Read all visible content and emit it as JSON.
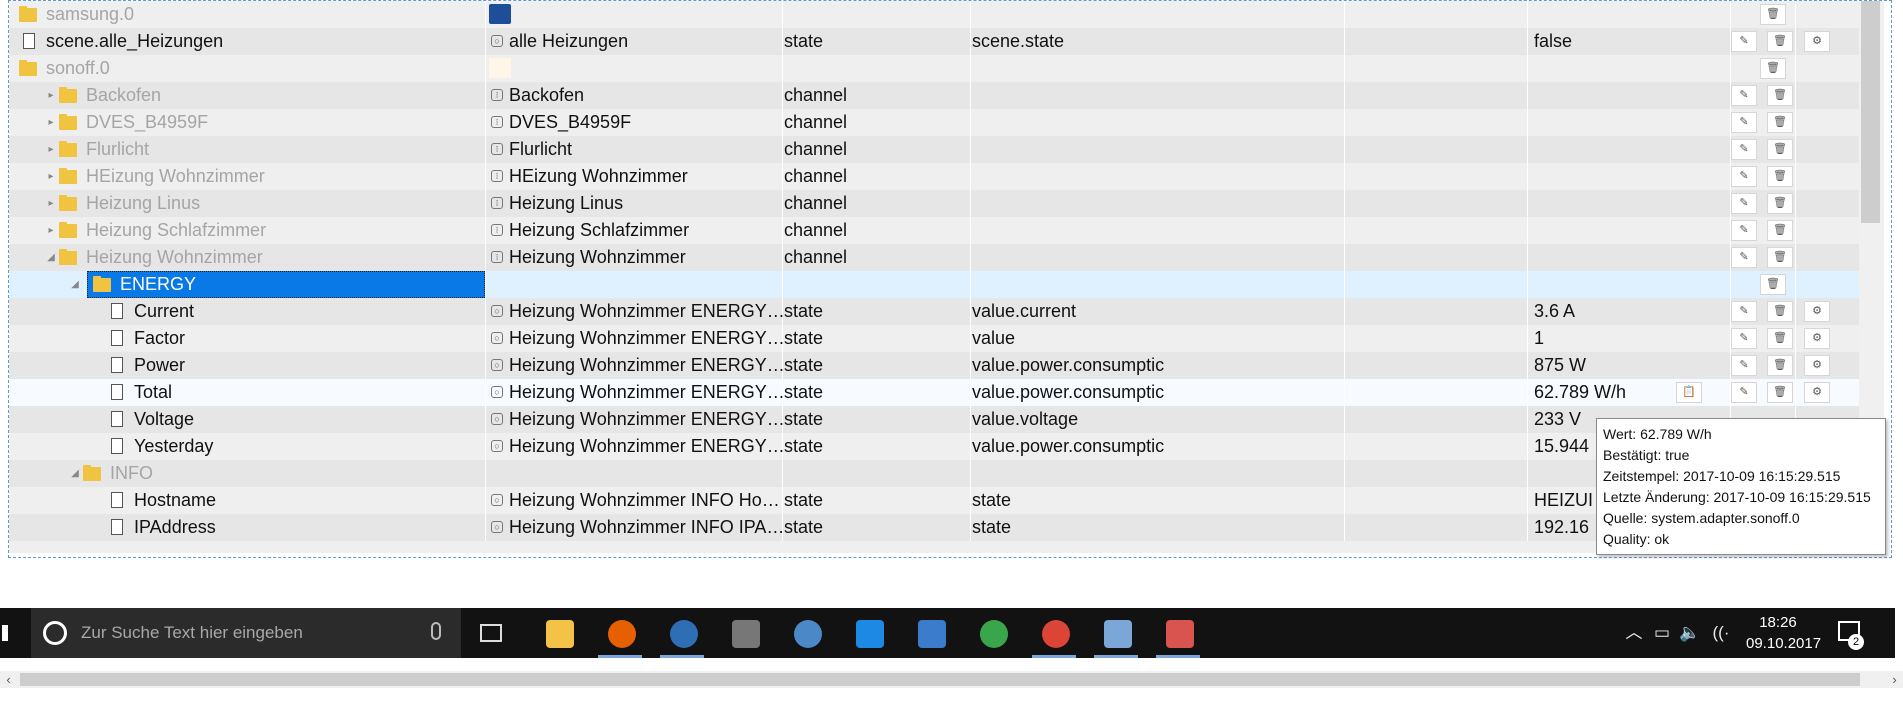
{
  "search": {
    "placeholder": "Zur Suche Text hier eingeben"
  },
  "rows": [
    {
      "name": "samsung.0",
      "dim": true,
      "kind": "folder",
      "indent": 0,
      "logo": "samsung",
      "col_name": "",
      "col_type": "",
      "col_role": "",
      "col_value": "",
      "btns": [
        "trash-icon"
      ]
    },
    {
      "name": "scene.alle_Heizungen",
      "dim": false,
      "kind": "file",
      "indent": 0,
      "typeicon": "state",
      "col_name": "alle Heizungen",
      "col_type": "state",
      "col_role": "scene.state",
      "col_value": "false",
      "btns": [
        "edit-icon",
        "trash-icon",
        "gear-icon"
      ]
    },
    {
      "name": "sonoff.0",
      "dim": true,
      "kind": "folder",
      "indent": 0,
      "logo": "sonoff",
      "col_name": "",
      "col_type": "",
      "col_role": "",
      "col_value": "",
      "btns": [
        "trash-icon"
      ]
    },
    {
      "name": "Backofen",
      "dim": true,
      "kind": "folder",
      "indent": 1,
      "tri": "▸",
      "typeicon": "channel",
      "col_name": "Backofen",
      "col_type": "channel",
      "col_role": "",
      "col_value": "",
      "btns": [
        "edit-icon",
        "trash-icon"
      ]
    },
    {
      "name": "DVES_B4959F",
      "dim": true,
      "kind": "folder",
      "indent": 1,
      "tri": "▸",
      "typeicon": "channel",
      "col_name": "DVES_B4959F",
      "col_type": "channel",
      "col_role": "",
      "col_value": "",
      "btns": [
        "edit-icon",
        "trash-icon"
      ]
    },
    {
      "name": "Flurlicht",
      "dim": true,
      "kind": "folder",
      "indent": 1,
      "tri": "▸",
      "typeicon": "channel",
      "col_name": "Flurlicht",
      "col_type": "channel",
      "col_role": "",
      "col_value": "",
      "btns": [
        "edit-icon",
        "trash-icon"
      ]
    },
    {
      "name": "HEizung Wohnzimmer",
      "dim": true,
      "kind": "folder",
      "indent": 1,
      "tri": "▸",
      "typeicon": "channel",
      "col_name": "HEizung Wohnzimmer",
      "col_type": "channel",
      "col_role": "",
      "col_value": "",
      "btns": [
        "edit-icon",
        "trash-icon"
      ]
    },
    {
      "name": "Heizung Linus",
      "dim": true,
      "kind": "folder",
      "indent": 1,
      "tri": "▸",
      "typeicon": "channel",
      "col_name": "Heizung Linus",
      "col_type": "channel",
      "col_role": "",
      "col_value": "",
      "btns": [
        "edit-icon",
        "trash-icon"
      ]
    },
    {
      "name": "Heizung Schlafzimmer",
      "dim": true,
      "kind": "folder",
      "indent": 1,
      "tri": "▸",
      "typeicon": "channel",
      "col_name": "Heizung Schlafzimmer",
      "col_type": "channel",
      "col_role": "",
      "col_value": "",
      "btns": [
        "edit-icon",
        "trash-icon"
      ]
    },
    {
      "name": "Heizung Wohnzimmer",
      "dim": true,
      "kind": "folder",
      "indent": 1,
      "tri": "◢",
      "typeicon": "channel",
      "col_name": "Heizung Wohnzimmer",
      "col_type": "channel",
      "col_role": "",
      "col_value": "",
      "btns": [
        "edit-icon",
        "trash-icon"
      ]
    },
    {
      "name": "ENERGY",
      "dim": false,
      "selected": true,
      "kind": "folder",
      "indent": 2,
      "tri": "◢",
      "col_name": "",
      "col_type": "",
      "col_role": "",
      "col_value": "",
      "btns": [
        "trash-icon"
      ]
    },
    {
      "name": "Current",
      "dim": false,
      "kind": "file",
      "indent": 3,
      "typeicon": "state",
      "col_name": "Heizung Wohnzimmer ENERGY…",
      "col_type": "state",
      "col_role": "value.current",
      "col_value": "3.6 A",
      "btns": [
        "edit-icon",
        "trash-icon",
        "gear-icon"
      ]
    },
    {
      "name": "Factor",
      "dim": false,
      "kind": "file",
      "indent": 3,
      "typeicon": "state",
      "col_name": "Heizung Wohnzimmer ENERGY…",
      "col_type": "state",
      "col_role": "value",
      "col_value": "1",
      "btns": [
        "edit-icon",
        "trash-icon",
        "gear-icon"
      ]
    },
    {
      "name": "Power",
      "dim": false,
      "kind": "file",
      "indent": 3,
      "typeicon": "state",
      "col_name": "Heizung Wohnzimmer ENERGY…",
      "col_type": "state",
      "col_role": "value.power.consumptic",
      "col_value": "875 W",
      "btns": [
        "edit-icon",
        "trash-icon",
        "gear-icon"
      ]
    },
    {
      "name": "Total",
      "dim": false,
      "hover": true,
      "kind": "file",
      "indent": 3,
      "typeicon": "state",
      "col_name": "Heizung Wohnzimmer ENERGY…",
      "col_type": "state",
      "col_role": "value.power.consumptic",
      "col_value": "62.789 W/h",
      "btns": [
        "clipboard-icon",
        "edit-icon",
        "trash-icon",
        "gear-icon"
      ]
    },
    {
      "name": "Voltage",
      "dim": false,
      "kind": "file",
      "indent": 3,
      "typeicon": "state",
      "col_name": "Heizung Wohnzimmer ENERGY…",
      "col_type": "state",
      "col_role": "value.voltage",
      "col_value": "233 V",
      "btns": []
    },
    {
      "name": "Yesterday",
      "dim": false,
      "kind": "file",
      "indent": 3,
      "typeicon": "state",
      "col_name": "Heizung Wohnzimmer ENERGY…",
      "col_type": "state",
      "col_role": "value.power.consumptic",
      "col_value": "15.944",
      "btns": []
    },
    {
      "name": "INFO",
      "dim": true,
      "kind": "folder",
      "indent": 2,
      "tri": "◢",
      "col_name": "",
      "col_type": "",
      "col_role": "",
      "col_value": "",
      "btns": []
    },
    {
      "name": "Hostname",
      "dim": false,
      "kind": "file",
      "indent": 3,
      "typeicon": "state",
      "col_name": "Heizung Wohnzimmer INFO Ho…",
      "col_type": "state",
      "col_role": "state",
      "col_value": "HEIZUI",
      "btns": []
    },
    {
      "name": "IPAddress",
      "dim": false,
      "kind": "file",
      "indent": 3,
      "typeicon": "state",
      "col_name": "Heizung Wohnzimmer INFO IPA…",
      "col_type": "state",
      "col_role": "state",
      "col_value": "192.16",
      "btns": []
    }
  ],
  "tooltip": [
    "Wert: 62.789 W/h",
    "Bestätigt: true",
    "Zeitstempel: 2017-10-09 16:15:29.515",
    "Letzte Änderung: 2017-10-09 16:15:29.515",
    "Quelle: system.adapter.sonoff.0",
    "Quality: ok"
  ],
  "taskbar": {
    "apps": [
      {
        "name": "file-explorer-icon",
        "color": "#f4c246"
      },
      {
        "name": "firefox-icon",
        "color": "#e66000",
        "active": true
      },
      {
        "name": "thunderbird-icon",
        "color": "#2e6eb5",
        "active": true
      },
      {
        "name": "world-of-tanks-icon",
        "color": "#777777"
      },
      {
        "name": "media-center-icon",
        "color": "#4b88c7"
      },
      {
        "name": "store-icon",
        "color": "#1e88e5"
      },
      {
        "name": "network-icon",
        "color": "#3b7ccc"
      },
      {
        "name": "atom-icon",
        "color": "#3aa64b"
      },
      {
        "name": "chrome-icon",
        "color": "#db4437",
        "active": true
      },
      {
        "name": "paint-icon",
        "color": "#7aa7d8",
        "active": true
      },
      {
        "name": "snipping-tool-icon",
        "color": "#d9534f",
        "active": true
      }
    ],
    "tray": {
      "chevron": "︿",
      "battery": "▭",
      "volume": "🔈",
      "wifi": "((·"
    },
    "time": "18:26",
    "date": "09.10.2017",
    "notifications": "2"
  },
  "colors": {
    "selection": "#0a79e8",
    "tooltip_border": "#8a8a8a",
    "taskbar": "#121212"
  }
}
